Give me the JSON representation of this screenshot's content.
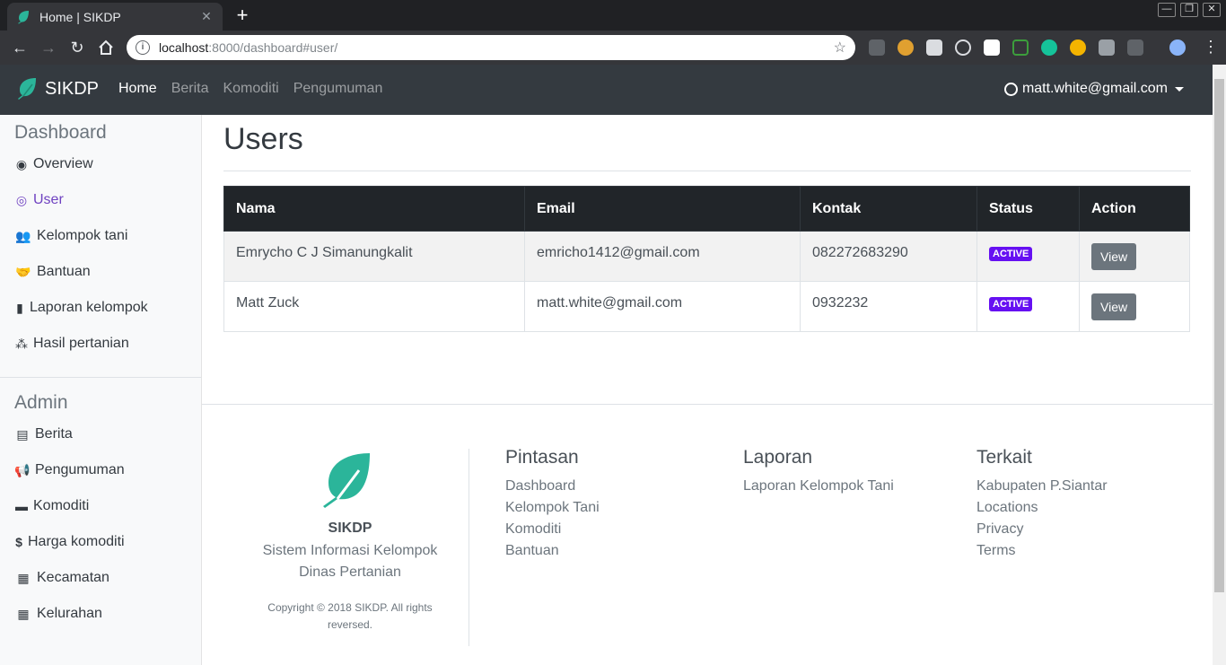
{
  "browser": {
    "tab_title": "Home | SIKDP",
    "tab_close": "✕",
    "new_tab": "+",
    "url_host": "localhost",
    "url_rest": ":8000/dashboard#user/",
    "info": "i",
    "win_min": "—",
    "win_max": "❐",
    "win_close": "✕"
  },
  "navbar": {
    "brand": "SIKDP",
    "links": [
      "Home",
      "Berita",
      "Komoditi",
      "Pengumuman"
    ],
    "user_email": "matt.white@gmail.com"
  },
  "sidebar": {
    "dashboard_heading": "Dashboard",
    "dashboard_items": [
      {
        "label": "Overview",
        "icon": "dot-circle-icon"
      },
      {
        "label": "User",
        "icon": "user-circle-icon",
        "active": true
      },
      {
        "label": "Kelompok tani",
        "icon": "users-icon"
      },
      {
        "label": "Bantuan",
        "icon": "handshake-icon"
      },
      {
        "label": "Laporan kelompok",
        "icon": "file-icon"
      },
      {
        "label": "Hasil pertanian",
        "icon": "cubes-icon"
      }
    ],
    "admin_heading": "Admin",
    "admin_items": [
      {
        "label": "Berita",
        "icon": "newspaper-icon"
      },
      {
        "label": "Pengumuman",
        "icon": "bullhorn-icon"
      },
      {
        "label": "Komoditi",
        "icon": "archive-icon"
      },
      {
        "label": "Harga komoditi",
        "icon": "dollar-icon"
      },
      {
        "label": "Kecamatan",
        "icon": "building-icon"
      },
      {
        "label": "Kelurahan",
        "icon": "building-icon"
      }
    ]
  },
  "main": {
    "title": "Users",
    "table": {
      "headers": [
        "Nama",
        "Email",
        "Kontak",
        "Status",
        "Action"
      ],
      "rows": [
        {
          "nama": "Emrycho C J Simanungkalit",
          "email": "emricho1412@gmail.com",
          "kontak": "082272683290",
          "status": "ACTIVE",
          "action": "View"
        },
        {
          "nama": "Matt Zuck",
          "email": "matt.white@gmail.com",
          "kontak": "0932232",
          "status": "ACTIVE",
          "action": "View"
        }
      ]
    }
  },
  "footer": {
    "name": "SIKDP",
    "desc_line1": "Sistem Informasi Kelompok",
    "desc_line2": "Dinas Pertanian",
    "copyright_line1": "Copyright © 2018 SIKDP. All rights",
    "copyright_line2": "reversed.",
    "pintasan": {
      "heading": "Pintasan",
      "links": [
        "Dashboard",
        "Kelompok Tani",
        "Komoditi",
        "Bantuan"
      ]
    },
    "laporan": {
      "heading": "Laporan",
      "links": [
        "Laporan Kelompok Tani"
      ]
    },
    "terkait": {
      "heading": "Terkait",
      "links": [
        "Kabupaten P.Siantar",
        "Locations",
        "Privacy",
        "Terms"
      ]
    }
  },
  "colors": {
    "navbar_bg": "#343a40",
    "accent_active": "#6f42c1",
    "badge": "#6610f2",
    "logo_teal": "#2bb59a"
  }
}
